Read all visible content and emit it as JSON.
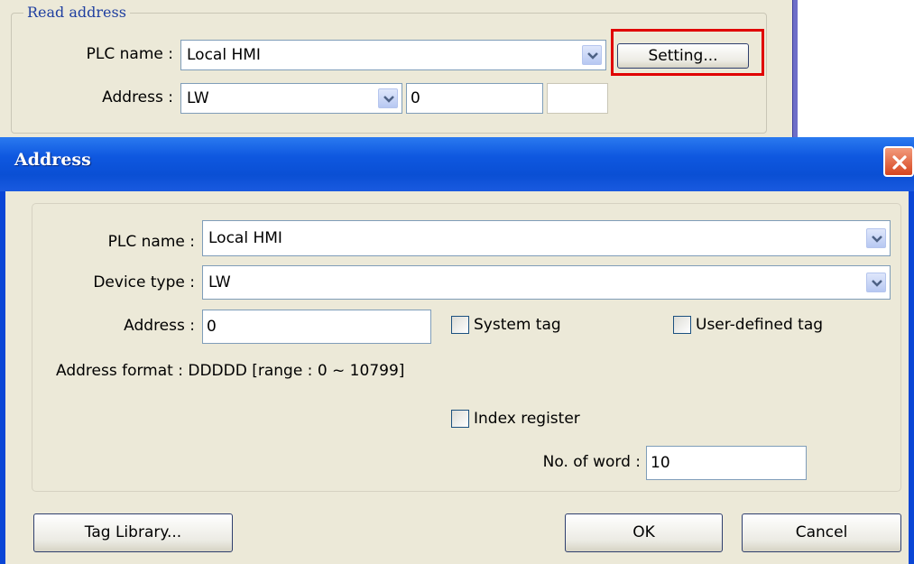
{
  "read_address": {
    "group_label": "Read address",
    "plc_name_label": "PLC name :",
    "plc_name_value": "Local HMI",
    "setting_button": "Setting...",
    "address_label": "Address :",
    "device_value": "LW",
    "address_value": "0"
  },
  "dialog": {
    "title": "Address",
    "plc_name_label": "PLC name :",
    "plc_name_value": "Local HMI",
    "device_type_label": "Device type :",
    "device_type_value": "LW",
    "address_label": "Address :",
    "address_value": "0",
    "system_tag_label": "System tag",
    "user_defined_tag_label": "User-defined tag",
    "address_format": "Address format : DDDDD [range : 0 ~ 10799]",
    "index_register_label": "Index register",
    "no_of_word_label": "No. of word :",
    "no_of_word_value": "10",
    "tag_library_button": "Tag Library...",
    "ok_button": "OK",
    "cancel_button": "Cancel"
  },
  "colors": {
    "highlight": "#e00000",
    "titlebar": "#0a4fd4",
    "face": "#ece9d8"
  },
  "icons": [
    "chevron-down-icon",
    "close-icon"
  ]
}
